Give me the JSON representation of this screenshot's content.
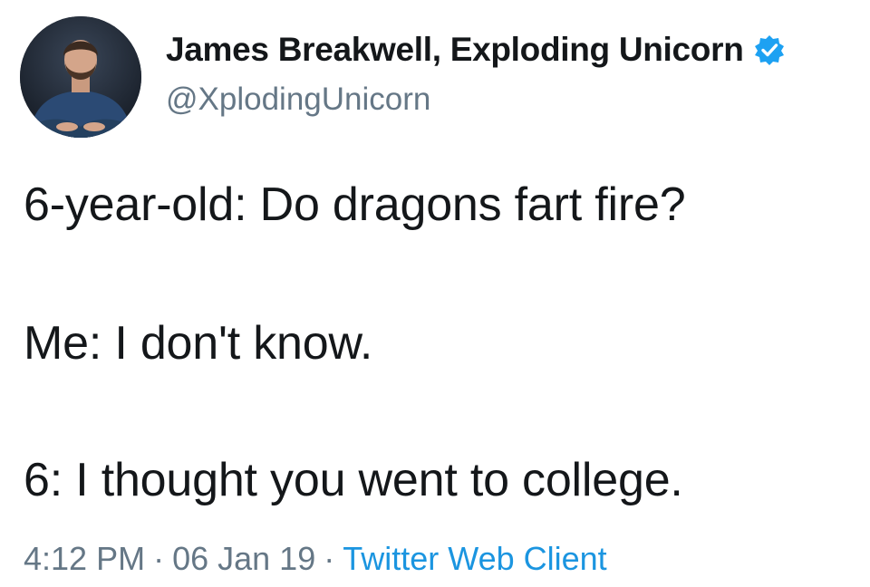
{
  "author": {
    "display_name": "James Breakwell, Exploding Unicorn",
    "handle": "@XplodingUnicorn",
    "verified_icon": "verified-badge-icon",
    "avatar_icon": "avatar-photo"
  },
  "tweet": {
    "lines": [
      "6-year-old: Do dragons fart fire?",
      "Me: I don't know.",
      "6: I thought you went to college."
    ]
  },
  "meta": {
    "time": "4:12 PM",
    "separator": "·",
    "date": "06 Jan 19",
    "client": "Twitter Web Client"
  },
  "colors": {
    "text": "#14171a",
    "secondary": "#657786",
    "link": "#1b95e0",
    "verified": "#1da1f2"
  }
}
